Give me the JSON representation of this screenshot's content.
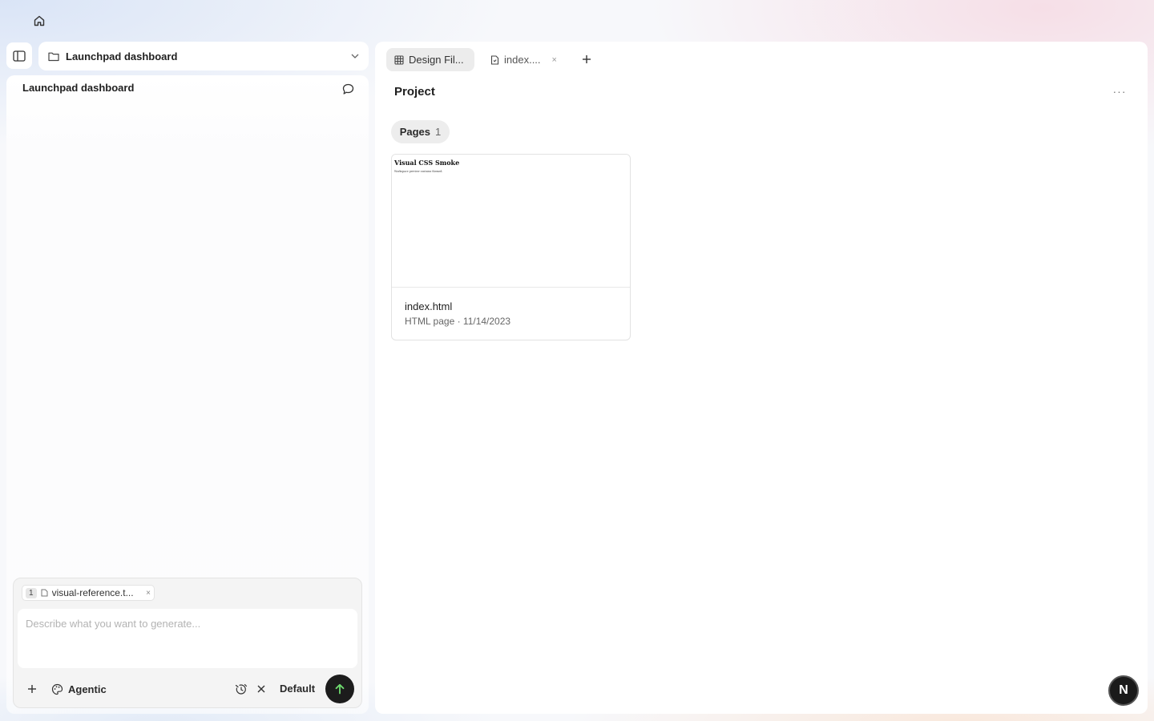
{
  "icons": {
    "home": "home-icon",
    "sidebar_toggle": "sidebar-panel-icon",
    "folder": "folder-icon",
    "chevron": "chevron-down-icon",
    "comment": "comment-icon",
    "grid": "table-grid-icon",
    "file": "file-icon",
    "plus": "plus-icon",
    "palette": "palette-icon",
    "send": "arrow-up-icon"
  },
  "colors": {
    "send_button": "#1c1c1c",
    "send_arrow": "#6fdc6f",
    "active_tab": "#ececec"
  },
  "left_panel": {
    "project_select": {
      "label": "Launchpad dashboard"
    },
    "chat_title": "Launchpad dashboard",
    "composer": {
      "attachment": {
        "count": "1",
        "name": "visual-reference.t...",
        "remove": "×"
      },
      "placeholder": "Describe what you want to generate...",
      "value": "",
      "mode_label": "Agentic",
      "clear_label": "×",
      "model_label": "Default"
    }
  },
  "main": {
    "tabs": [
      {
        "label": "Design Fil..."
      },
      {
        "label": "index....",
        "close": "×"
      }
    ],
    "add_tab": "+",
    "title": "Project",
    "more": "···",
    "pages_filter": {
      "label": "Pages",
      "count": "1"
    },
    "cards": [
      {
        "preview_title": "Visual CSS Smoke",
        "preview_subtitle": "Workspace preview contains themed.",
        "name": "index.html",
        "meta": "HTML page · 11/14/2023"
      }
    ]
  },
  "user": {
    "avatar_initial": "N"
  }
}
